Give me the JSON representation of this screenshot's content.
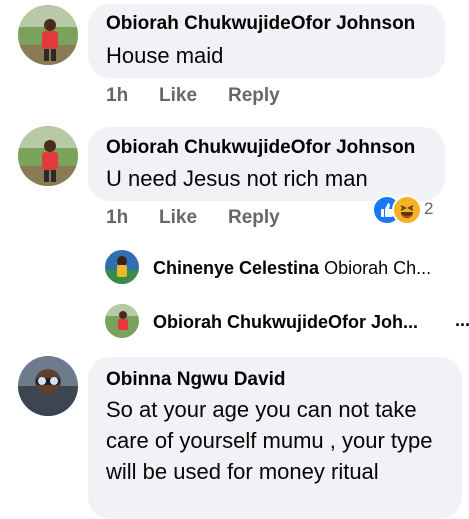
{
  "comments": [
    {
      "author": "Obiorah ChukwujideOfor Johnson",
      "text": "House maid",
      "time": "1h",
      "like_label": "Like",
      "reply_label": "Reply"
    },
    {
      "author": "Obiorah ChukwujideOfor Johnson",
      "text": "U need Jesus not rich man",
      "time": "1h",
      "like_label": "Like",
      "reply_label": "Reply",
      "reaction_count": "2"
    },
    {
      "author": "Obinna Ngwu David",
      "text": "So at your age you can not take care of yourself mumu , your type will be used for money ritual"
    }
  ],
  "replies": [
    {
      "author": "Chinenye Celestina",
      "text": "Obiorah Ch..."
    },
    {
      "author": "Obiorah ChukwujideOfor Joh...",
      "text": ""
    }
  ],
  "more_icon": "ellipsis-icon",
  "colors": {
    "bubble": "#f0f2f5",
    "meta": "#65676b",
    "like_blue": "#1877f2",
    "haha_yellow": "#f7b125"
  }
}
